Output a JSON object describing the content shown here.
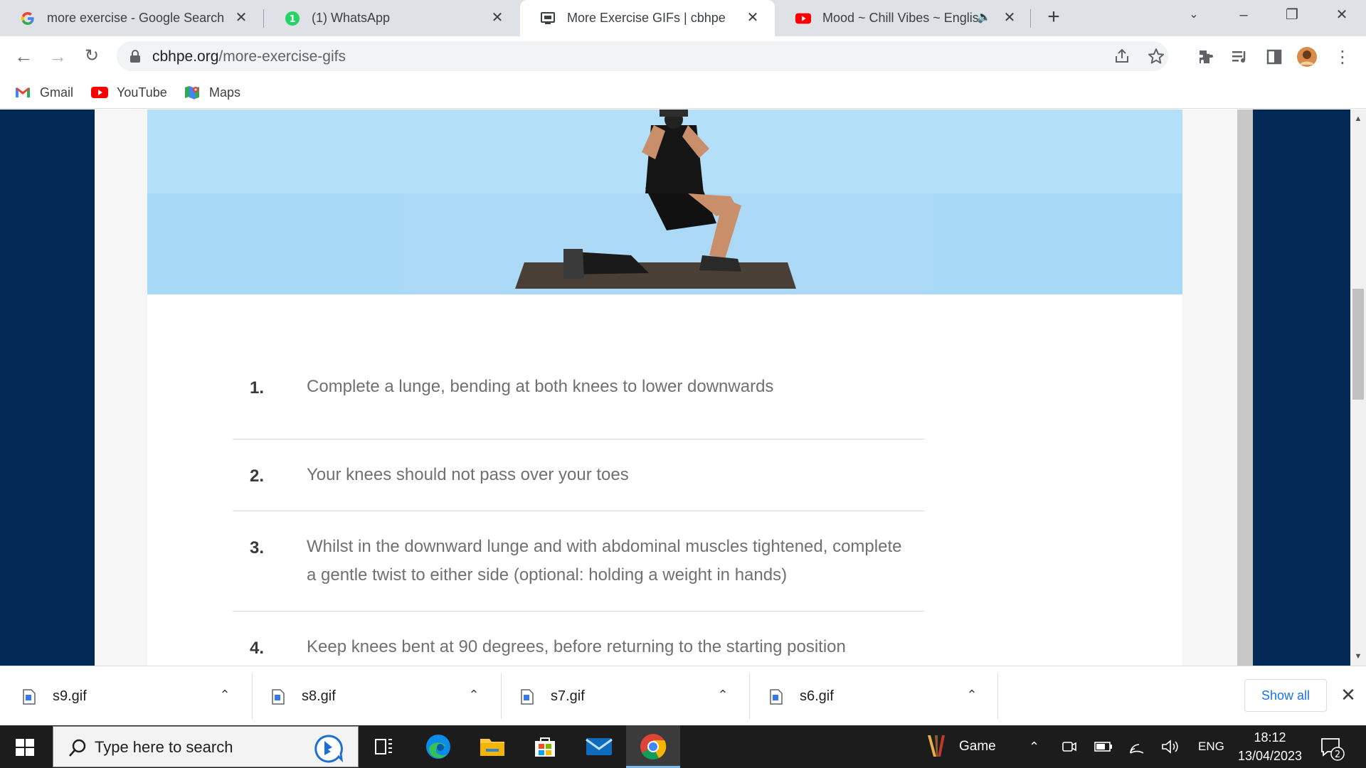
{
  "browser": {
    "tabs": [
      {
        "title": "more exercise - Google Search",
        "favicon": "google-g-icon",
        "active": false
      },
      {
        "title": "(1) WhatsApp",
        "favicon": "whatsapp-icon",
        "badge": "1",
        "active": false
      },
      {
        "title": "More Exercise GIFs | cbhpe",
        "favicon": "page-icon",
        "active": true
      },
      {
        "title": "Mood ~ Chill Vibes ~ English",
        "favicon": "youtube-icon",
        "active": false,
        "audio": true
      }
    ],
    "address": {
      "domain": "cbhpe.org",
      "path": "/more-exercise-gifs"
    },
    "bookmarks": [
      {
        "label": "Gmail",
        "icon": "gmail-icon"
      },
      {
        "label": "YouTube",
        "icon": "youtube-icon"
      },
      {
        "label": "Maps",
        "icon": "maps-icon"
      }
    ]
  },
  "page": {
    "steps": [
      {
        "num": "1.",
        "text": "Complete a lunge, bending at both knees to lower downwards"
      },
      {
        "num": "2.",
        "text": "Your knees should not pass over your toes"
      },
      {
        "num": "3.",
        "text": "Whilst in the downward lunge and with abdominal muscles tightened, complete a gentle twist to either side (optional: holding a weight in hands)"
      },
      {
        "num": "4.",
        "text": "Keep knees bent at 90 degrees, before returning to the starting position"
      }
    ]
  },
  "downloads": {
    "items": [
      {
        "name": "s9.gif"
      },
      {
        "name": "s8.gif"
      },
      {
        "name": "s7.gif"
      },
      {
        "name": "s6.gif"
      }
    ],
    "show_all": "Show all"
  },
  "taskbar": {
    "search_placeholder": "Type here to search",
    "game_label": "Game",
    "language": "ENG",
    "time": "18:12",
    "date": "13/04/2023",
    "notification_count": "2"
  },
  "colors": {
    "page_background": "#032a57",
    "hero_background": "#b4dff8",
    "accent_blue": "#1a73e8"
  }
}
